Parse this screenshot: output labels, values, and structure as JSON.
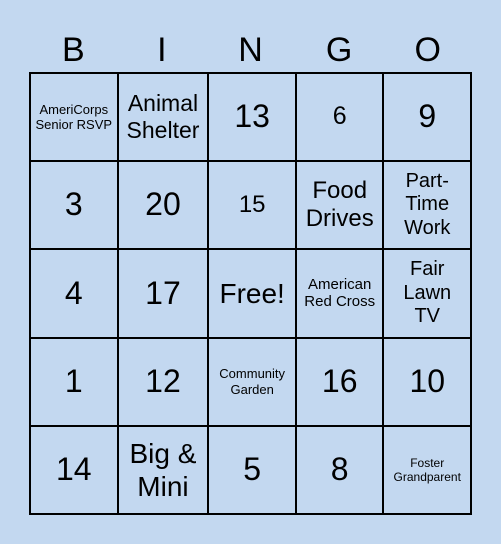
{
  "header": [
    "B",
    "I",
    "N",
    "G",
    "O"
  ],
  "cells": [
    "AmeriCorps Senior RSVP",
    "Animal Shelter",
    "13",
    "6",
    "9",
    "3",
    "20",
    "15",
    "Food Drives",
    "Part-Time Work",
    "4",
    "17",
    "Free!",
    "American Red Cross",
    "Fair Lawn TV",
    "1",
    "12",
    "Community Garden",
    "16",
    "10",
    "14",
    "Big & Mini",
    "5",
    "8",
    "Foster Grandparent"
  ],
  "colors": {
    "background": "#c3d8f0",
    "grid_lines": "#000000"
  }
}
